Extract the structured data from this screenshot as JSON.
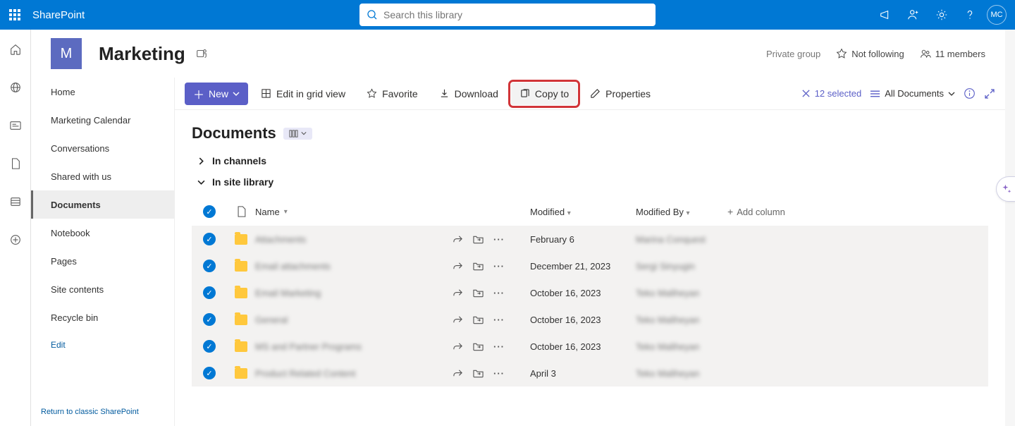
{
  "brand": "SharePoint",
  "search": {
    "placeholder": "Search this library"
  },
  "avatar_initials": "MC",
  "site": {
    "tile_letter": "M",
    "title": "Marketing",
    "privacy": "Private group",
    "follow_label": "Not following",
    "members_label": "11 members"
  },
  "nav": {
    "items": [
      "Home",
      "Marketing Calendar",
      "Conversations",
      "Shared with us",
      "Documents",
      "Notebook",
      "Pages",
      "Site contents",
      "Recycle bin"
    ],
    "active_index": 4,
    "edit": "Edit",
    "classic": "Return to classic SharePoint"
  },
  "cmd": {
    "new": "New",
    "grid": "Edit in grid view",
    "favorite": "Favorite",
    "download": "Download",
    "copyto": "Copy to",
    "properties": "Properties",
    "selected": "12 selected",
    "view": "All Documents"
  },
  "page": {
    "title": "Documents"
  },
  "sections": {
    "channels": "In channels",
    "library": "In site library"
  },
  "columns": {
    "name": "Name",
    "modified": "Modified",
    "modified_by": "Modified By",
    "add": "Add column"
  },
  "rows": [
    {
      "name": "Attachments",
      "modified": "February 6",
      "by": "Marina Conquest"
    },
    {
      "name": "Email attachments",
      "modified": "December 21, 2023",
      "by": "Sergi Sinyugin"
    },
    {
      "name": "Email Marketing",
      "modified": "October 16, 2023",
      "by": "Teko Maliheyan"
    },
    {
      "name": "General",
      "modified": "October 16, 2023",
      "by": "Teko Maliheyan"
    },
    {
      "name": "MS and Partner Programs",
      "modified": "October 16, 2023",
      "by": "Teko Maliheyan"
    },
    {
      "name": "Product Related Content",
      "modified": "April 3",
      "by": "Teko Maliheyan"
    }
  ]
}
